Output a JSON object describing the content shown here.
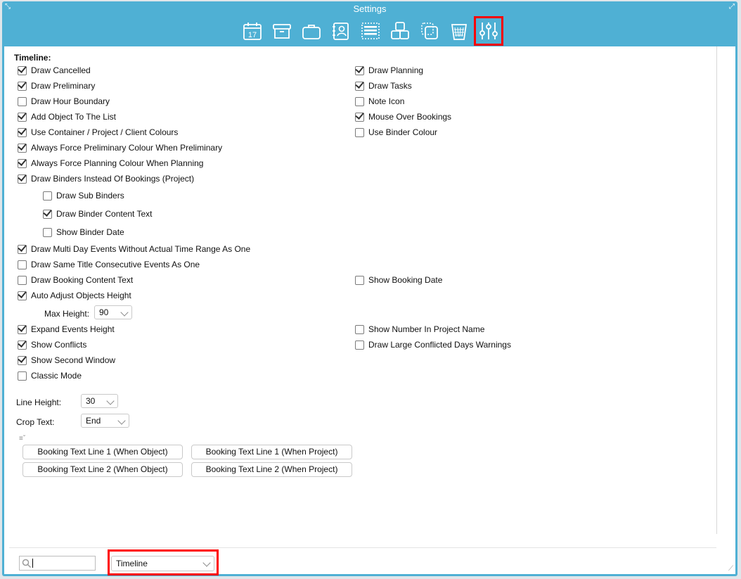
{
  "window": {
    "title": "Settings"
  },
  "toolbar": {
    "icons": [
      "calendar-icon",
      "archive-box-icon",
      "briefcase-icon",
      "contact-book-icon",
      "list-icon",
      "blocks-icon",
      "copy-icon",
      "trash-icon",
      "sliders-icon"
    ],
    "calendar_day": "17",
    "selected": "sliders-icon"
  },
  "section": {
    "title": "Timeline:"
  },
  "left_options": [
    {
      "label": "Draw Cancelled",
      "checked": true
    },
    {
      "label": "Draw Preliminary",
      "checked": true
    },
    {
      "label": "Draw Hour Boundary",
      "checked": false
    },
    {
      "label": "Add Object To The List",
      "checked": true
    },
    {
      "label": "Use Container / Project / Client Colours",
      "checked": true
    },
    {
      "label": "Always Force Preliminary Colour When Preliminary",
      "checked": true
    },
    {
      "label": "Always Force Planning Colour When Planning",
      "checked": true
    },
    {
      "label": "Draw Binders Instead Of Bookings (Project)",
      "checked": true
    },
    {
      "label": "Draw Sub Binders",
      "checked": false
    },
    {
      "label": "Draw Binder Content Text",
      "checked": true
    },
    {
      "label": "Show Binder Date",
      "checked": false
    },
    {
      "label": "Draw Multi Day Events Without Actual Time Range As One",
      "checked": true
    },
    {
      "label": "Draw Same Title Consecutive Events As One",
      "checked": false
    },
    {
      "label": "Draw Booking Content Text",
      "checked": false
    },
    {
      "label": "Auto Adjust Objects Height",
      "checked": true
    },
    {
      "label": "Expand Events Height",
      "checked": true
    },
    {
      "label": "Show Conflicts",
      "checked": true
    },
    {
      "label": "Show Second Window",
      "checked": true
    },
    {
      "label": "Classic Mode",
      "checked": false
    }
  ],
  "right_options": [
    {
      "label": "Draw Planning",
      "checked": true
    },
    {
      "label": "Draw Tasks",
      "checked": true
    },
    {
      "label": "Note Icon",
      "checked": false
    },
    {
      "label": "Mouse Over Bookings",
      "checked": true
    },
    {
      "label": "Use Binder Colour",
      "checked": false
    },
    {
      "label": "Show Booking Date",
      "checked": false
    },
    {
      "label": "Show Number In Project Name",
      "checked": false
    },
    {
      "label": "Draw Large Conflicted Days Warnings",
      "checked": false
    }
  ],
  "max_height": {
    "label": "Max Height:",
    "value": "90"
  },
  "line_height": {
    "label": "Line Height:",
    "value": "30"
  },
  "crop_text": {
    "label": "Crop Text:",
    "value": "End"
  },
  "buttons": {
    "b1": "Booking Text Line 1 (When Object)",
    "b2": "Booking Text Line 1 (When Project)",
    "b3": "Booking Text Line 2 (When Object)",
    "b4": "Booking Text Line 2 (When Project)"
  },
  "footer": {
    "search_value": "",
    "section_select": "Timeline"
  },
  "colors": {
    "titlebar": "#4fb0d4",
    "highlight": "#ff0000"
  }
}
